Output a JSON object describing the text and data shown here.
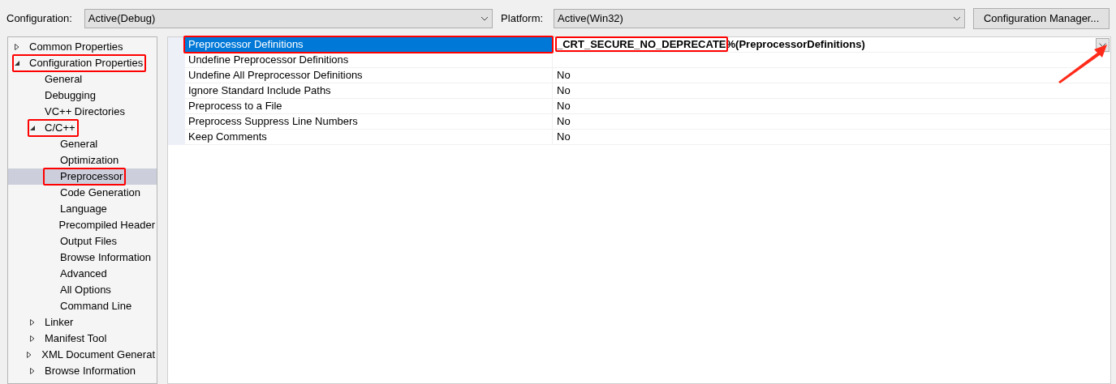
{
  "toolbar": {
    "configuration_label": "Configuration:",
    "configuration": "Active(Debug)",
    "platform_label": "Platform:",
    "platform": "Active(Win32)",
    "manager_button": "Configuration Manager..."
  },
  "tree": [
    {
      "label": "Common Properties",
      "expanded": false,
      "selected": false,
      "highlighted": false
    },
    {
      "label": "Configuration Properties",
      "expanded": true,
      "selected": false,
      "highlighted": true,
      "children": [
        {
          "label": "General",
          "selected": false,
          "highlighted": false
        },
        {
          "label": "Debugging",
          "selected": false,
          "highlighted": false
        },
        {
          "label": "VC++ Directories",
          "selected": false,
          "highlighted": false
        },
        {
          "label": "C/C++",
          "expanded": true,
          "selected": false,
          "highlighted": true,
          "children": [
            {
              "label": "General",
              "selected": false,
              "highlighted": false
            },
            {
              "label": "Optimization",
              "selected": false,
              "highlighted": false
            },
            {
              "label": "Preprocessor",
              "selected": true,
              "highlighted": true
            },
            {
              "label": "Code Generation",
              "selected": false,
              "highlighted": false
            },
            {
              "label": "Language",
              "selected": false,
              "highlighted": false
            },
            {
              "label": "Precompiled Header",
              "selected": false,
              "highlighted": false
            },
            {
              "label": "Output Files",
              "selected": false,
              "highlighted": false
            },
            {
              "label": "Browse Information",
              "selected": false,
              "highlighted": false
            },
            {
              "label": "Advanced",
              "selected": false,
              "highlighted": false
            },
            {
              "label": "All Options",
              "selected": false,
              "highlighted": false
            },
            {
              "label": "Command Line",
              "selected": false,
              "highlighted": false
            }
          ]
        },
        {
          "label": "Linker",
          "expanded": false,
          "selected": false,
          "highlighted": false
        },
        {
          "label": "Manifest Tool",
          "expanded": false,
          "selected": false,
          "highlighted": false
        },
        {
          "label": "XML Document Generat",
          "expanded": false,
          "selected": false,
          "highlighted": false
        },
        {
          "label": "Browse Information",
          "expanded": false,
          "selected": false,
          "highlighted": false
        }
      ]
    }
  ],
  "properties": [
    {
      "name": "Preprocessor Definitions",
      "value": "_CRT_SECURE_NO_DEPRECATE",
      "value_rest": "%(PreprocessorDefinitions)",
      "selected": true,
      "highlighted": true,
      "bold": true,
      "dropdown": true
    },
    {
      "name": "Undefine Preprocessor Definitions",
      "selected": false,
      "highlighted": false,
      "bold": false
    },
    {
      "name": "Undefine All Preprocessor Definitions",
      "value": "No",
      "selected": false,
      "highlighted": false,
      "bold": false
    },
    {
      "name": "Ignore Standard Include Paths",
      "value": "No",
      "selected": false,
      "highlighted": false,
      "bold": false
    },
    {
      "name": "Preprocess to a File",
      "value": "No",
      "selected": false,
      "highlighted": false,
      "bold": false
    },
    {
      "name": "Preprocess Suppress Line Numbers",
      "value": "No",
      "selected": false,
      "highlighted": false,
      "bold": false
    },
    {
      "name": "Keep Comments",
      "value": "No",
      "selected": false,
      "highlighted": false,
      "bold": false
    }
  ]
}
